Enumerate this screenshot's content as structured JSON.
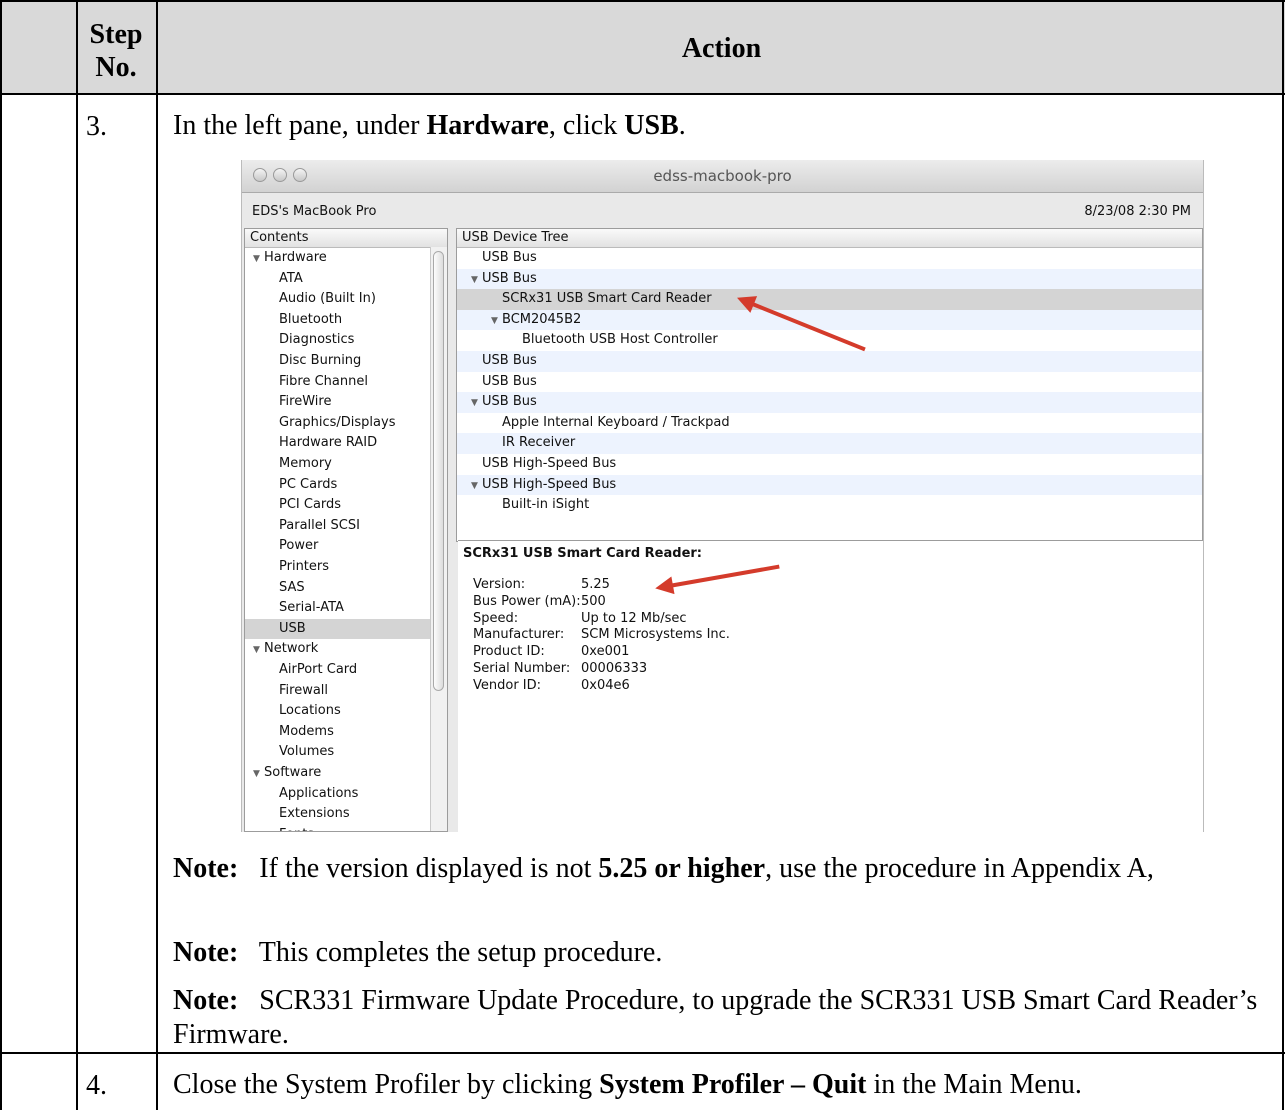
{
  "table_header": {
    "step_label": "Step No.",
    "action_label": "Action"
  },
  "step3": {
    "number": "3.",
    "instruction_prefix": "In the left pane, under ",
    "instruction_bold1": "Hardware",
    "instruction_mid": ", click ",
    "instruction_bold2": "USB",
    "instruction_suffix": ".",
    "note1_label": "Note:",
    "note1_text_a": "If the version displayed is not ",
    "note1_bold": "5.25 or higher",
    "note1_text_b": ", use the procedure in Appendix A,",
    "note2_label": "Note:",
    "note2_text": "This completes the setup procedure.",
    "note3_label": "Note:",
    "note3_text": "SCR331 Firmware Update Procedure, to upgrade the SCR331 USB Smart Card Reader’s Firmware."
  },
  "step4": {
    "number": "4.",
    "text_prefix": "Close the System Profiler by clicking ",
    "text_bold": "System Profiler – Quit",
    "text_suffix": " in the Main Menu."
  },
  "screenshot": {
    "window_title": "edss-macbook-pro",
    "machine_name": "EDS's MacBook Pro",
    "datetime": "8/23/08 2:30 PM",
    "contents_header": "Contents",
    "contents": [
      {
        "label": "Hardware",
        "level": 0,
        "group": true
      },
      {
        "label": "ATA",
        "level": 1
      },
      {
        "label": "Audio (Built In)",
        "level": 1
      },
      {
        "label": "Bluetooth",
        "level": 1
      },
      {
        "label": "Diagnostics",
        "level": 1
      },
      {
        "label": "Disc Burning",
        "level": 1
      },
      {
        "label": "Fibre Channel",
        "level": 1
      },
      {
        "label": "FireWire",
        "level": 1
      },
      {
        "label": "Graphics/Displays",
        "level": 1
      },
      {
        "label": "Hardware RAID",
        "level": 1
      },
      {
        "label": "Memory",
        "level": 1
      },
      {
        "label": "PC Cards",
        "level": 1
      },
      {
        "label": "PCI Cards",
        "level": 1
      },
      {
        "label": "Parallel SCSI",
        "level": 1
      },
      {
        "label": "Power",
        "level": 1
      },
      {
        "label": "Printers",
        "level": 1
      },
      {
        "label": "SAS",
        "level": 1
      },
      {
        "label": "Serial-ATA",
        "level": 1
      },
      {
        "label": "USB",
        "level": 1,
        "selected": true
      },
      {
        "label": "Network",
        "level": 0,
        "group": true
      },
      {
        "label": "AirPort Card",
        "level": 1
      },
      {
        "label": "Firewall",
        "level": 1
      },
      {
        "label": "Locations",
        "level": 1
      },
      {
        "label": "Modems",
        "level": 1
      },
      {
        "label": "Volumes",
        "level": 1
      },
      {
        "label": "Software",
        "level": 0,
        "group": true
      },
      {
        "label": "Applications",
        "level": 1
      },
      {
        "label": "Extensions",
        "level": 1
      },
      {
        "label": "Fonts",
        "level": 1
      }
    ],
    "tree_header": "USB Device Tree",
    "tree": [
      {
        "label": "USB Bus",
        "level": 0
      },
      {
        "label": "USB Bus",
        "level": 0,
        "expanded": true
      },
      {
        "label": "SCRx31 USB Smart Card Reader",
        "level": 1,
        "selected": true
      },
      {
        "label": "BCM2045B2",
        "level": 1,
        "expanded": true
      },
      {
        "label": "Bluetooth USB Host Controller",
        "level": 2
      },
      {
        "label": "USB Bus",
        "level": 0
      },
      {
        "label": "USB Bus",
        "level": 0
      },
      {
        "label": "USB Bus",
        "level": 0,
        "expanded": true
      },
      {
        "label": "Apple Internal Keyboard / Trackpad",
        "level": 1
      },
      {
        "label": "IR Receiver",
        "level": 1
      },
      {
        "label": "USB High-Speed Bus",
        "level": 0
      },
      {
        "label": "USB High-Speed Bus",
        "level": 0,
        "expanded": true
      },
      {
        "label": "Built-in iSight",
        "level": 1
      }
    ],
    "detail_title": "SCRx31 USB Smart Card Reader:",
    "details": [
      {
        "key": "Version:",
        "value": "5.25"
      },
      {
        "key": "Bus Power (mA):",
        "value": "500"
      },
      {
        "key": "Speed:",
        "value": "Up to 12 Mb/sec"
      },
      {
        "key": "Manufacturer:",
        "value": "SCM Microsystems Inc."
      },
      {
        "key": "Product ID:",
        "value": "0xe001"
      },
      {
        "key": "Serial Number:",
        "value": "00006333"
      },
      {
        "key": "Vendor ID:",
        "value": "0x04e6"
      }
    ],
    "colors": {
      "annotation_arrow": "#d43b2b",
      "selection": "#d4d4d4",
      "alt_row": "#edf3fe"
    }
  }
}
